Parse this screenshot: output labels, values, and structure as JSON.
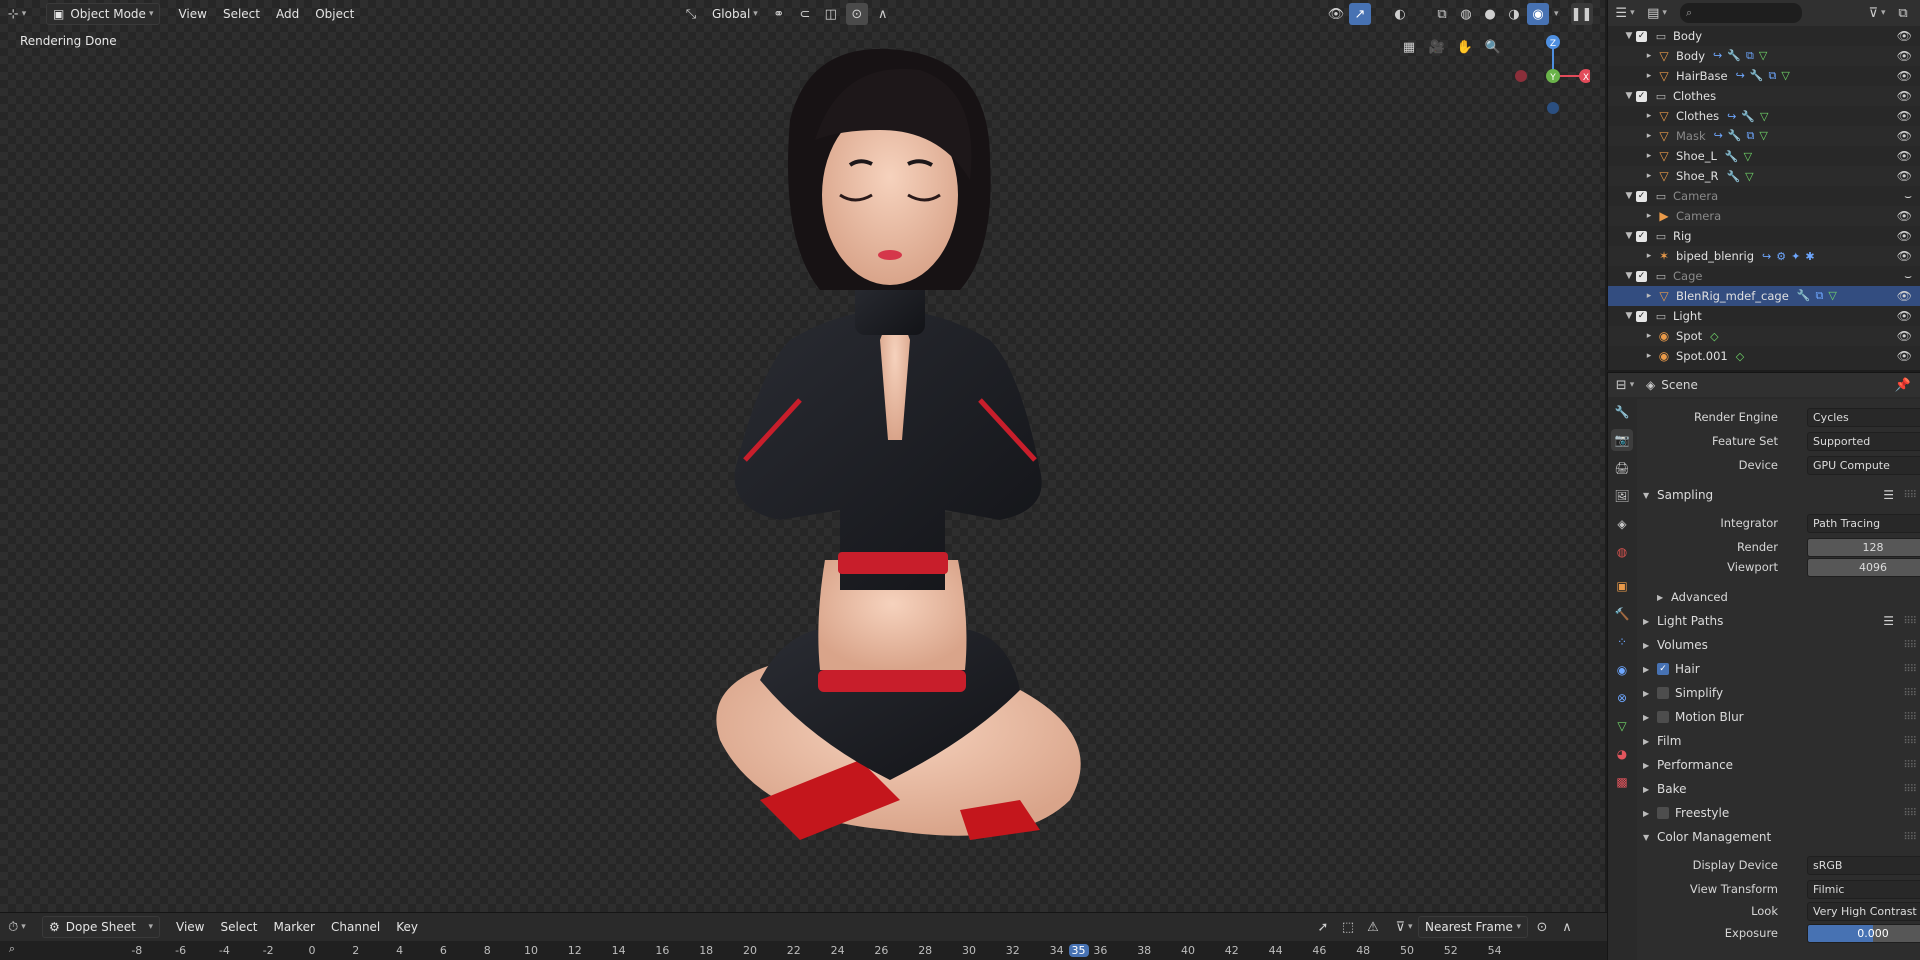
{
  "viewport_header": {
    "mode_label": "Object Mode",
    "menus": [
      "View",
      "Select",
      "Add",
      "Object"
    ],
    "orientation_label": "Global"
  },
  "viewport": {
    "status_text": "Rendering Done",
    "gizmo": {
      "z": "Z",
      "y": "Y",
      "x": "X"
    }
  },
  "timeline": {
    "editor_label": "Dope Sheet",
    "menus": [
      "View",
      "Select",
      "Marker",
      "Channel",
      "Key"
    ],
    "snap_label": "Nearest Frame",
    "ticks": [
      "-8",
      "-6",
      "-4",
      "-2",
      "0",
      "2",
      "4",
      "6",
      "8",
      "10",
      "12",
      "14",
      "16",
      "18",
      "20",
      "22",
      "24",
      "26",
      "28",
      "30",
      "32",
      "34",
      "35",
      "36",
      "38",
      "40",
      "42",
      "44",
      "46",
      "48",
      "50",
      "52",
      "54"
    ],
    "current_frame": "35"
  },
  "outliner": {
    "rows": [
      {
        "name": "Body",
        "type": "collection",
        "level": 0,
        "checked": true
      },
      {
        "name": "Body",
        "type": "object",
        "level": 1
      },
      {
        "name": "HairBase",
        "type": "object",
        "level": 1
      },
      {
        "name": "Clothes",
        "type": "collection",
        "level": 0,
        "checked": true
      },
      {
        "name": "Clothes",
        "type": "object",
        "level": 1
      },
      {
        "name": "Mask",
        "type": "object",
        "level": 1,
        "dim": true
      },
      {
        "name": "Shoe_L",
        "type": "object",
        "level": 1
      },
      {
        "name": "Shoe_R",
        "type": "object",
        "level": 1
      },
      {
        "name": "Camera",
        "type": "collection",
        "level": 0,
        "checked": true,
        "dim": true
      },
      {
        "name": "Camera",
        "type": "object",
        "level": 1,
        "dim": true
      },
      {
        "name": "Rig",
        "type": "collection",
        "level": 0,
        "checked": true
      },
      {
        "name": "biped_blenrig",
        "type": "object",
        "level": 1
      },
      {
        "name": "Cage",
        "type": "collection",
        "level": 0,
        "checked": true,
        "dim": true
      },
      {
        "name": "BlenRig_mdef_cage",
        "type": "object",
        "level": 1,
        "selected": true
      },
      {
        "name": "Light",
        "type": "collection",
        "level": 0,
        "checked": true
      },
      {
        "name": "Spot",
        "type": "object",
        "level": 1
      },
      {
        "name": "Spot.001",
        "type": "object",
        "level": 1
      }
    ]
  },
  "properties": {
    "context_label": "Scene",
    "render_engine": {
      "label": "Render Engine",
      "value": "Cycles"
    },
    "feature_set": {
      "label": "Feature Set",
      "value": "Supported"
    },
    "device": {
      "label": "Device",
      "value": "GPU Compute"
    },
    "sampling": {
      "title": "Sampling",
      "integrator": {
        "label": "Integrator",
        "value": "Path Tracing"
      },
      "render": {
        "label": "Render",
        "value": "128"
      },
      "viewport": {
        "label": "Viewport",
        "value": "4096"
      },
      "advanced": "Advanced"
    },
    "panels": {
      "light_paths": "Light Paths",
      "volumes": "Volumes",
      "hair": "Hair",
      "simplify": "Simplify",
      "motion_blur": "Motion Blur",
      "film": "Film",
      "performance": "Performance",
      "bake": "Bake",
      "freestyle": "Freestyle",
      "color_management": "Color Management"
    },
    "color_management": {
      "display_device": {
        "label": "Display Device",
        "value": "sRGB"
      },
      "view_transform": {
        "label": "View Transform",
        "value": "Filmic"
      },
      "look": {
        "label": "Look",
        "value": "Very High Contrast"
      },
      "exposure": {
        "label": "Exposure",
        "value": "0.000",
        "fill_fraction": 0.5
      }
    }
  },
  "colors": {
    "accent": "#4772b3",
    "object_orange": "#e99a4a",
    "modifier_blue": "#6ea7ff",
    "data_green": "#72d96a"
  }
}
